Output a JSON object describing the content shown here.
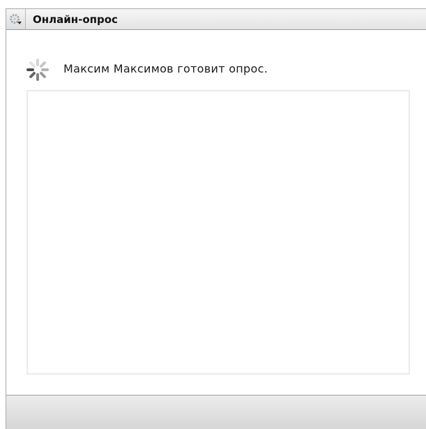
{
  "window": {
    "title": "Онлайн-опрос",
    "menu_icon": "gear-menu-icon"
  },
  "status": {
    "icon": "loading-spinner-icon",
    "text": "Максим Максимов готовит опрос."
  },
  "colors": {
    "titlebar_bg": "#e8e8e8",
    "panel_border": "#e6ecee",
    "bottom_bar_bg": "#dcdcdc",
    "spinner": "#555555"
  }
}
